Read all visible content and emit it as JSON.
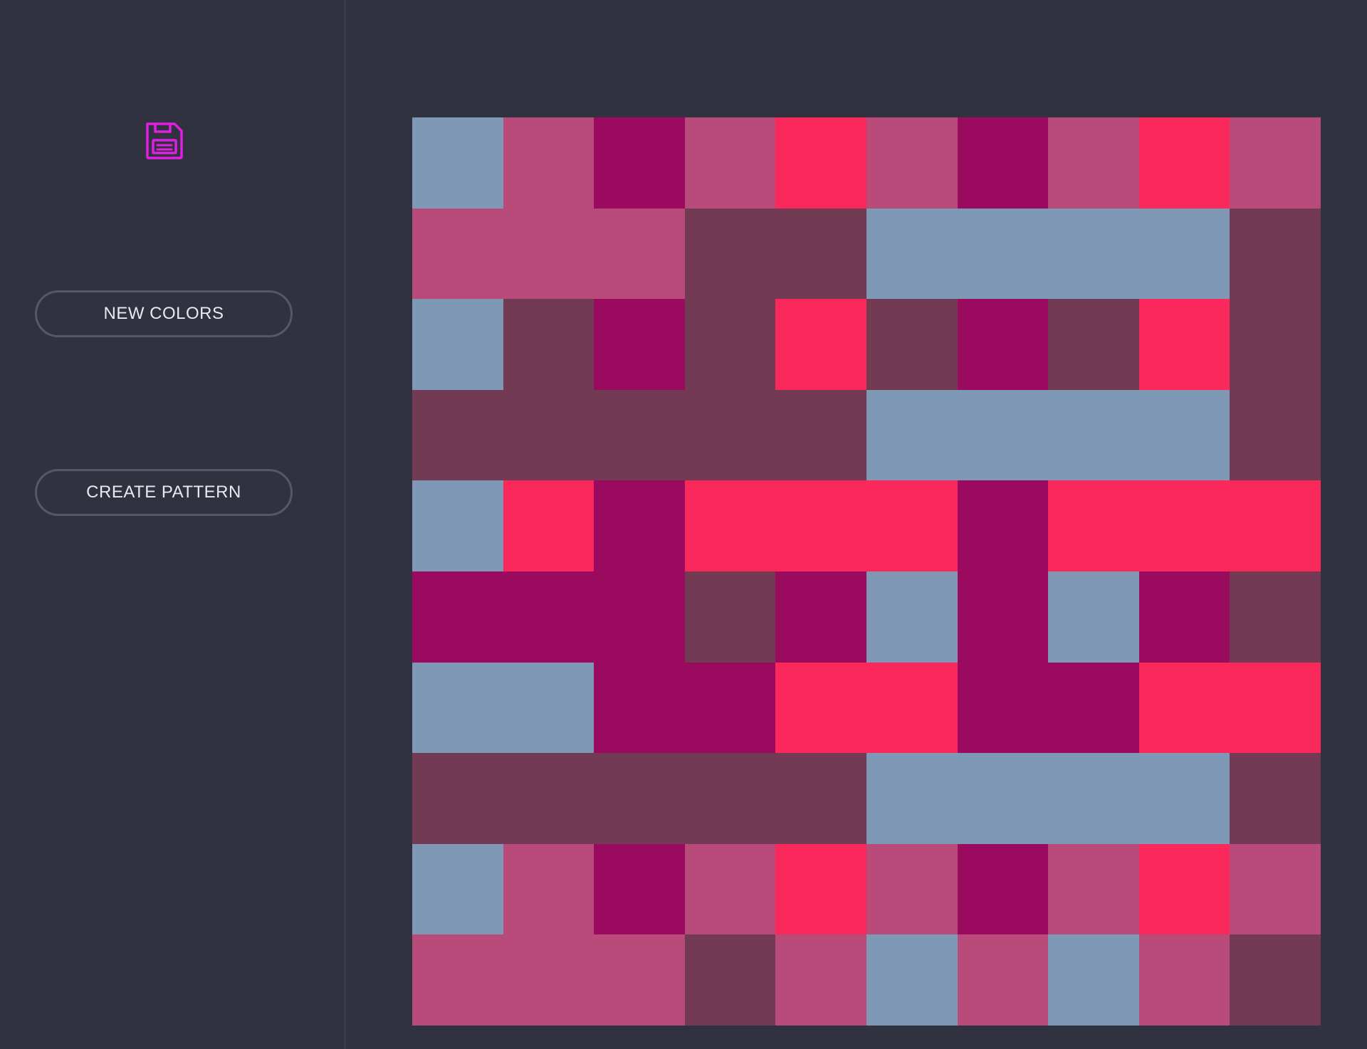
{
  "sidebar": {
    "save_icon": "floppy-disk-icon",
    "save_icon_color": "#e31ee3",
    "new_colors_label": "NEW COLORS",
    "create_pattern_label": "CREATE PATTERN"
  },
  "colors": {
    "background": "#313240",
    "palette": {
      "B": "#7e98b5",
      "P": "#b84b79",
      "M": "#9a0b60",
      "D": "#733a53",
      "R": "#fb285b"
    }
  },
  "pattern": {
    "rows": [
      [
        "B",
        "P",
        "M",
        "P",
        "R",
        "P",
        "M",
        "P",
        "R",
        "P"
      ],
      [
        "P",
        "P",
        "P",
        "D",
        "D",
        "B",
        "B",
        "B",
        "B",
        "D"
      ],
      [
        "B",
        "D",
        "M",
        "D",
        "R",
        "D",
        "M",
        "D",
        "R",
        "D"
      ],
      [
        "D",
        "D",
        "D",
        "D",
        "D",
        "B",
        "B",
        "B",
        "B",
        "D"
      ],
      [
        "B",
        "R",
        "M",
        "R",
        "R",
        "R",
        "M",
        "R",
        "R",
        "R"
      ],
      [
        "M",
        "M",
        "M",
        "D",
        "M",
        "B",
        "M",
        "B",
        "M",
        "D"
      ],
      [
        "B",
        "B",
        "M",
        "M",
        "R",
        "R",
        "M",
        "M",
        "R",
        "R"
      ],
      [
        "D",
        "D",
        "D",
        "D",
        "D",
        "B",
        "B",
        "B",
        "B",
        "D"
      ],
      [
        "B",
        "P",
        "M",
        "P",
        "R",
        "P",
        "M",
        "P",
        "R",
        "P"
      ],
      [
        "P",
        "P",
        "P",
        "D",
        "P",
        "B",
        "P",
        "B",
        "P",
        "D"
      ]
    ]
  }
}
